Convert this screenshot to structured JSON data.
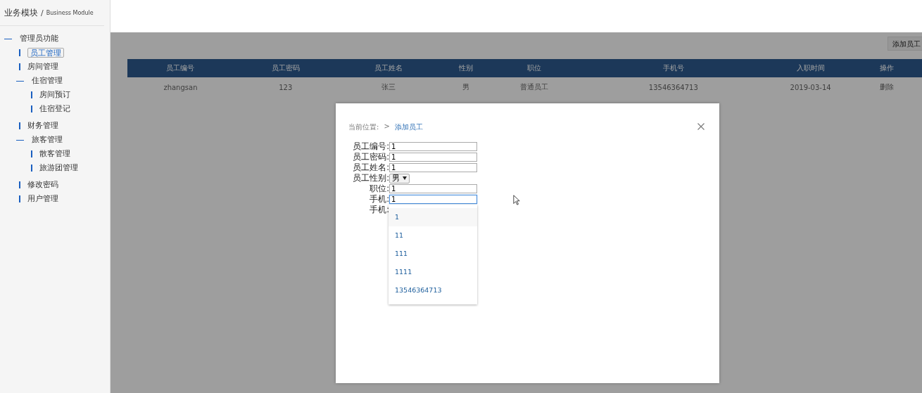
{
  "sidebar": {
    "title": "业务模块",
    "separator": "/",
    "subtitle": "Business Module",
    "items": [
      {
        "label": "管理员功能",
        "selected": false,
        "children": [
          {
            "label": "员工管理",
            "selected": true
          },
          {
            "label": "房间管理",
            "selected": false
          },
          {
            "label": "住宿管理",
            "selected": false,
            "children": [
              {
                "label": "房间预订",
                "selected": false
              },
              {
                "label": "住宿登记",
                "selected": false
              }
            ]
          },
          {
            "label": "财务管理",
            "selected": false
          },
          {
            "label": "旅客管理",
            "selected": false,
            "children": [
              {
                "label": "散客管理",
                "selected": false
              },
              {
                "label": "旅游团管理",
                "selected": false
              }
            ]
          },
          {
            "label": "修改密码",
            "selected": false
          },
          {
            "label": "用户管理",
            "selected": false
          }
        ]
      }
    ]
  },
  "toolbar": {
    "add_button": "添加员工"
  },
  "table": {
    "columns": [
      "员工编号",
      "员工密码",
      "员工姓名",
      "性别",
      "职位",
      "手机号",
      "入职时间",
      "操作"
    ],
    "rows": [
      [
        "zhangsan",
        "123",
        "张三",
        "男",
        "普通员工",
        "13546364713",
        "2019-03-14",
        "删除"
      ]
    ]
  },
  "dialog": {
    "breadcrumb_label": "当前位置:",
    "breadcrumb_sep": ">",
    "breadcrumb_current": "添加员工",
    "fields": [
      {
        "kind": "text",
        "label": "员工编号:",
        "value": "1",
        "focused": false
      },
      {
        "kind": "text",
        "label": "员工密码:",
        "value": "1",
        "focused": false
      },
      {
        "kind": "text",
        "label": "员工姓名:",
        "value": "1",
        "focused": false
      },
      {
        "kind": "select",
        "label": "员工性别:",
        "value": "男",
        "focused": false
      },
      {
        "kind": "text",
        "label": "职位:",
        "value": "1",
        "focused": false
      },
      {
        "kind": "text",
        "label": "手机:",
        "value": "1",
        "focused": true
      },
      {
        "kind": "label",
        "label": "手机:"
      }
    ],
    "suggestions": [
      "1",
      "11",
      "111",
      "1111",
      "13546364713"
    ]
  }
}
